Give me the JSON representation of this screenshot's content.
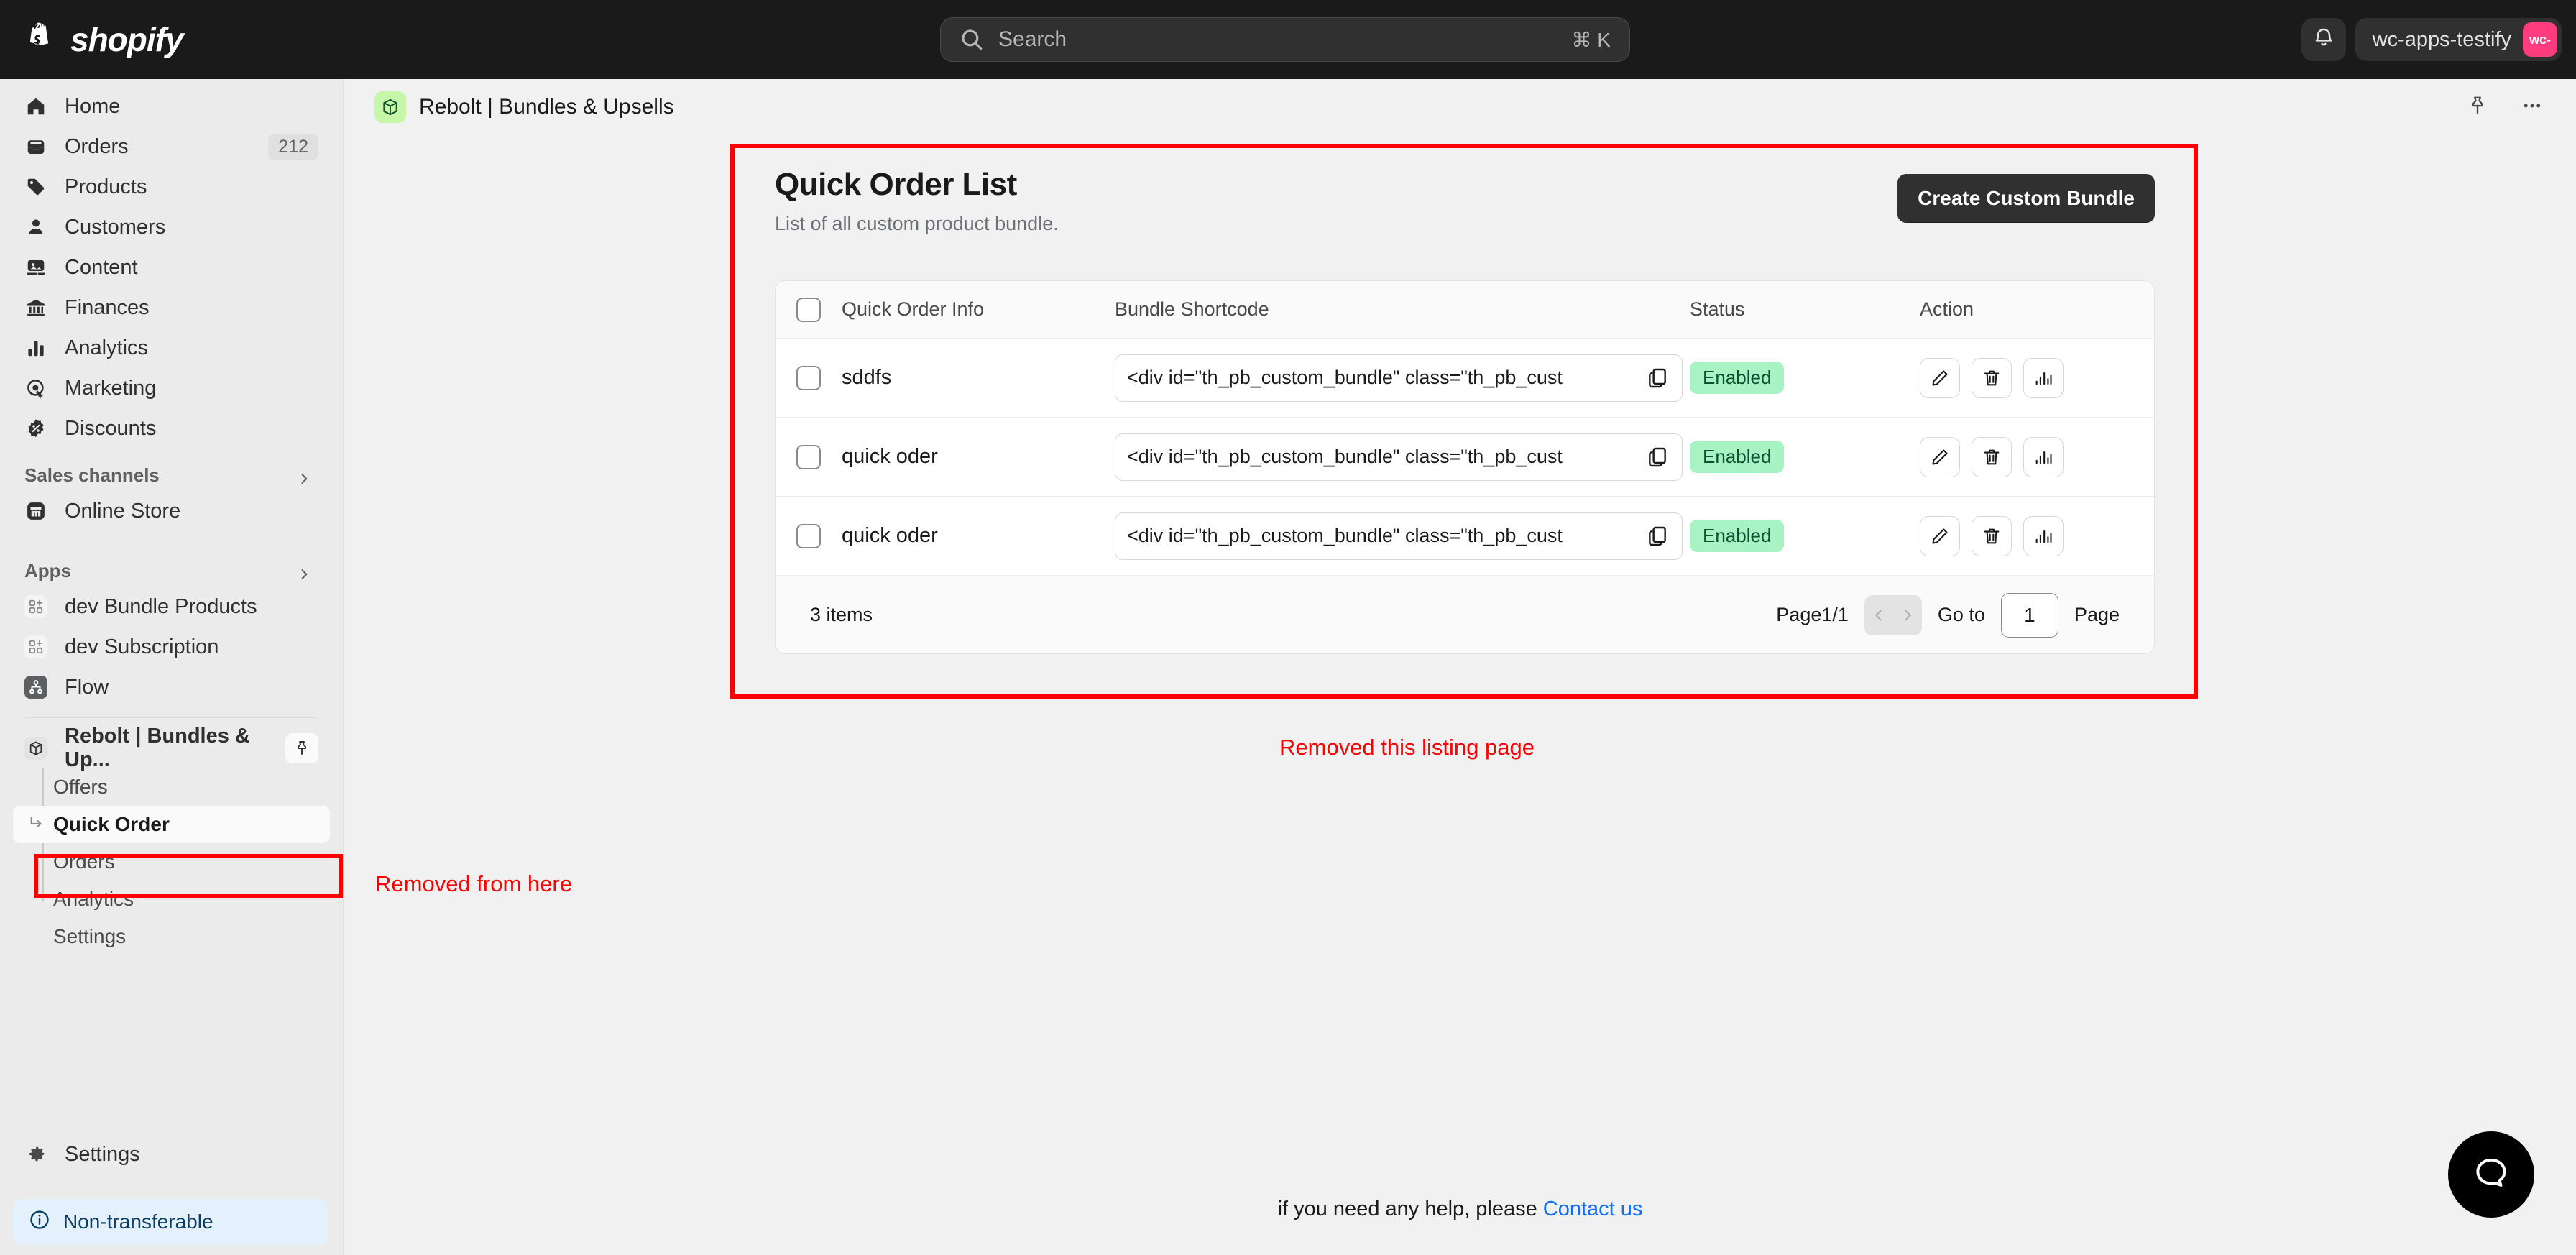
{
  "topbar": {
    "logo_text": "shopify",
    "logo_icon": "shopify-bag-icon",
    "search": {
      "placeholder": "Search",
      "shortcut": "⌘ K",
      "icon": "search-icon"
    },
    "notifications_icon": "bell-icon",
    "store_name": "wc-apps-testify",
    "store_avatar_initials": "wc-"
  },
  "sidebar": {
    "main_items": [
      {
        "label": "Home",
        "icon": "home-icon",
        "badge": null
      },
      {
        "label": "Orders",
        "icon": "orders-inbox-icon",
        "badge": "212"
      },
      {
        "label": "Products",
        "icon": "tag-icon",
        "badge": null
      },
      {
        "label": "Customers",
        "icon": "person-icon",
        "badge": null
      },
      {
        "label": "Content",
        "icon": "image-icon",
        "badge": null
      },
      {
        "label": "Finances",
        "icon": "bank-icon",
        "badge": null
      },
      {
        "label": "Analytics",
        "icon": "bar-chart-icon",
        "badge": null
      },
      {
        "label": "Marketing",
        "icon": "target-icon",
        "badge": null
      },
      {
        "label": "Discounts",
        "icon": "discount-badge-icon",
        "badge": null
      }
    ],
    "sales_channels_heading": "Sales channels",
    "sales_channels": [
      {
        "label": "Online Store",
        "icon": "storefront-icon"
      }
    ],
    "apps_heading": "Apps",
    "apps": [
      {
        "label": "dev Bundle Products",
        "icon": "app-blocks-icon"
      },
      {
        "label": "dev Subscription",
        "icon": "app-blocks-icon"
      },
      {
        "label": "Flow",
        "icon": "flow-nodes-icon"
      }
    ],
    "active_app": {
      "label": "Rebolt | Bundles & Up...",
      "icon": "package-icon",
      "pin_icon": "pin-icon"
    },
    "app_sub_items": [
      {
        "label": "Offers",
        "active": false
      },
      {
        "label": "Quick Order",
        "active": true
      },
      {
        "label": "Orders",
        "active": false
      },
      {
        "label": "Analytics",
        "active": false
      },
      {
        "label": "Settings",
        "active": false
      }
    ],
    "settings": {
      "label": "Settings",
      "icon": "gear-icon"
    },
    "non_transferable": {
      "label": "Non-transferable",
      "icon": "info-circle-icon"
    }
  },
  "page_header": {
    "app_icon": "rebolt-package-icon",
    "title": "Rebolt | Bundles & Upsells",
    "pin_icon": "pin-icon",
    "more_icon": "ellipsis-icon"
  },
  "main": {
    "title": "Quick Order List",
    "subtitle": "List of all custom product bundle.",
    "create_button": "Create Custom Bundle",
    "table": {
      "columns": [
        "Quick Order Info",
        "Bundle Shortcode",
        "Status",
        "Action"
      ],
      "select_all_checkbox": "select-all",
      "rows": [
        {
          "info": "sddfs",
          "shortcode": "<div id=\"th_pb_custom_bundle\" class=\"th_pb_cust",
          "status": "Enabled",
          "actions": [
            "edit-icon",
            "delete-icon",
            "stats-icon"
          ]
        },
        {
          "info": "quick oder",
          "shortcode": "<div id=\"th_pb_custom_bundle\" class=\"th_pb_cust",
          "status": "Enabled",
          "actions": [
            "edit-icon",
            "delete-icon",
            "stats-icon"
          ]
        },
        {
          "info": "quick oder",
          "shortcode": "<div id=\"th_pb_custom_bundle\" class=\"th_pb_cust",
          "status": "Enabled",
          "actions": [
            "edit-icon",
            "delete-icon",
            "stats-icon"
          ]
        }
      ]
    },
    "footer": {
      "items_count": "3 items",
      "page_label": "Page1/1",
      "goto_label": "Go to",
      "page_value": "1",
      "page_suffix": "Page"
    }
  },
  "annotations": {
    "listing": "Removed this listing page",
    "nav": "Removed from here",
    "highlight_color": "#ff0000"
  },
  "footer": {
    "help_text": "if you need any help, please ",
    "contact_link": "Contact us",
    "help_bubble_icon": "chat-bubble-icon"
  },
  "colors": {
    "topbar_bg": "#1a1a1a",
    "sidebar_bg": "#ebebeb",
    "accent_green": "#a7f3c4",
    "status_text": "#0c5132",
    "link_blue": "#0d6efd",
    "brand_pink": "#ff3c7e"
  }
}
